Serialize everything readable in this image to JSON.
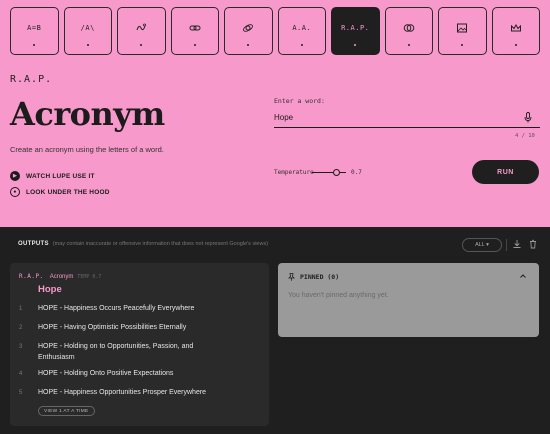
{
  "tabs": [
    {
      "label": "A=B",
      "icon": "text-glyph",
      "active": false
    },
    {
      "label": "/A\\",
      "icon": "text-glyph",
      "active": false
    },
    {
      "label": "",
      "icon": "squiggle-icon",
      "active": false
    },
    {
      "label": "",
      "icon": "link-icon",
      "active": false
    },
    {
      "label": "",
      "icon": "orbit-icon",
      "active": false
    },
    {
      "label": "A.A.",
      "icon": "text-glyph",
      "active": false
    },
    {
      "label": "R.A.P.",
      "icon": "text-glyph",
      "active": true
    },
    {
      "label": "",
      "icon": "overlap-circles-icon",
      "active": false
    },
    {
      "label": "",
      "icon": "image-icon",
      "active": false
    },
    {
      "label": "",
      "icon": "crown-icon",
      "active": false
    }
  ],
  "hero": {
    "mark": "R.A.P.",
    "title": "Acronym",
    "description": "Create an acronym using the letters of a word.",
    "watch_link": "WATCH LUPE USE IT",
    "hood_link": "LOOK UNDER THE HOOD"
  },
  "input": {
    "label": "Enter a word:",
    "value": "Hope",
    "counter": "4 / 10"
  },
  "temperature": {
    "label": "Temperature",
    "value_text": "0.7",
    "value": 0.7
  },
  "run_label": "RUN",
  "outputs": {
    "label": "OUTPUTS",
    "note": "(may contain inaccurate or offensive information that does not represent Google's views)",
    "filter": "ALL ▾"
  },
  "result": {
    "tag": "R.A.P.",
    "name": "Acronym",
    "meta": "TEMP 0.7",
    "word": "Hope",
    "items": [
      {
        "num": "1",
        "text": "HOPE - Happiness Occurs Peacefully Everywhere"
      },
      {
        "num": "2",
        "text": "HOPE - Having Optimistic Possibilities Eternally"
      },
      {
        "num": "3",
        "text": "HOPE - Holding on to Opportunities, Passion, and Enthusiasm"
      },
      {
        "num": "4",
        "text": "HOPE - Holding Onto Positive Expectations"
      },
      {
        "num": "5",
        "text": "HOPE - Happiness Opportunities Prosper Everywhere"
      }
    ],
    "more_label": "VIEW 1 AT A TIME"
  },
  "pinned": {
    "title": "PINNED (0)",
    "empty": "You haven't pinned anything yet."
  },
  "colors": {
    "accent_pink": "#f799cb",
    "dark_bg": "#1f1f1f",
    "card_bg": "#2a2a2a",
    "pinned_bg": "#9a9a9a"
  }
}
